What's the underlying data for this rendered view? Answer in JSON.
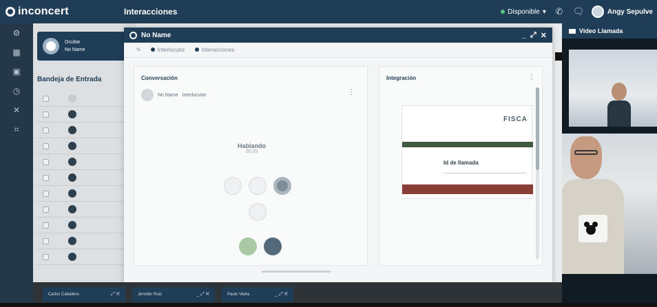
{
  "app": {
    "logo_text": "inconcert",
    "section_tab": "Interacciones",
    "status": "Disponible",
    "user_name": "Angy Sepulve"
  },
  "left_panel": {
    "agent_line1": "Ocultar",
    "agent_line2": "No Name",
    "inbox_title": "Bandeja de Entrada",
    "inbox_rows": 11
  },
  "chat_window": {
    "title": "No Name",
    "tabs": [
      "Interlocutor",
      "Interacciones"
    ],
    "conversation_title": "Conversación",
    "participant_name": "No Name",
    "participant_status": "Interlocutor",
    "talking_label": "Hablando",
    "timer": "00:05",
    "integration_title": "Integración",
    "form_brand": "FISCA",
    "form_field_label": "Id de llamada"
  },
  "video": {
    "title": "Video Llamada"
  },
  "minimized_chats": [
    {
      "label": "Carlos Caballero"
    },
    {
      "label": "Jennifer Ruiz"
    },
    {
      "label": "Paulo Vieira"
    }
  ],
  "colors": {
    "primary": "#1f3d57",
    "status_available": "#5cc77a"
  }
}
